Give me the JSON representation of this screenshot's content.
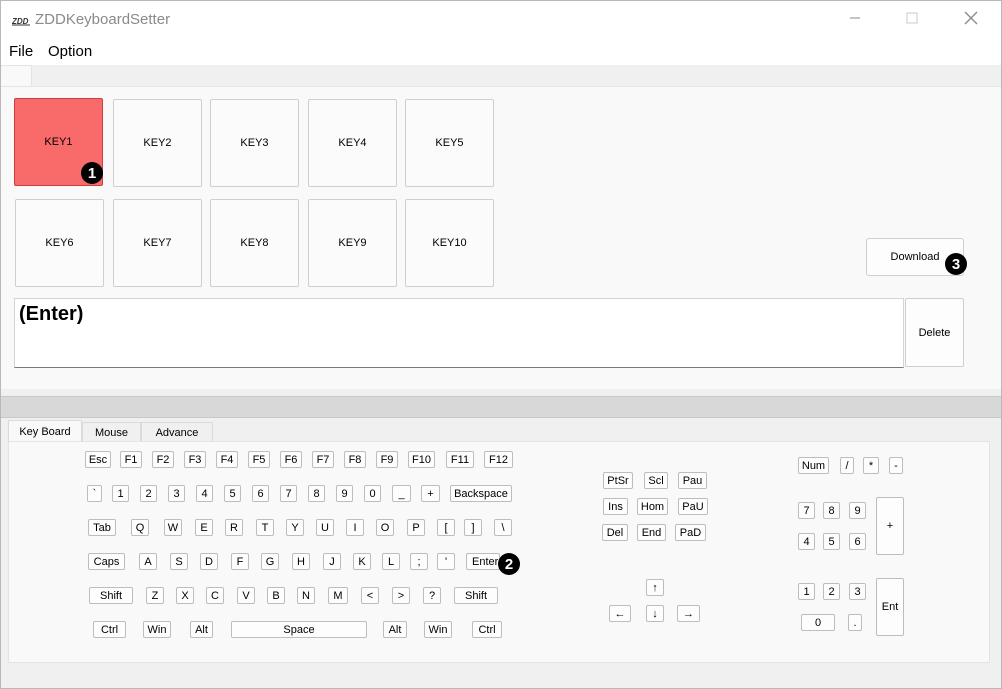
{
  "window": {
    "title": "ZDDKeyboardSetter",
    "icon": "zdd-logo-icon",
    "controls": [
      "minimize-icon",
      "maximize-icon",
      "close-icon"
    ]
  },
  "menu": {
    "file": "File",
    "option": "Option"
  },
  "keys": [
    {
      "label": "KEY1",
      "selected": true
    },
    {
      "label": "KEY2"
    },
    {
      "label": "KEY3"
    },
    {
      "label": "KEY4"
    },
    {
      "label": "KEY5"
    },
    {
      "label": "KEY6"
    },
    {
      "label": "KEY7"
    },
    {
      "label": "KEY8"
    },
    {
      "label": "KEY9"
    },
    {
      "label": "KEY10"
    }
  ],
  "download_label": "Download",
  "macro_text": "(Enter)",
  "delete_label": "Delete",
  "badges": {
    "b1": "1",
    "b2": "2",
    "b3": "3"
  },
  "tabs": {
    "keyboard": "Key Board",
    "mouse": "Mouse",
    "advance": "Advance"
  },
  "kb": {
    "fn": [
      "Esc",
      "F1",
      "F2",
      "F3",
      "F4",
      "F5",
      "F6",
      "F7",
      "F8",
      "F9",
      "F10",
      "F11",
      "F12"
    ],
    "num": [
      "`",
      "1",
      "2",
      "3",
      "4",
      "5",
      "6",
      "7",
      "8",
      "9",
      "0",
      "_",
      "+",
      "Backspace"
    ],
    "qwerty": [
      "Tab",
      "Q",
      "W",
      "E",
      "R",
      "T",
      "Y",
      "U",
      "I",
      "O",
      "P",
      "[",
      "]",
      "\\"
    ],
    "home": [
      "Caps",
      "A",
      "S",
      "D",
      "F",
      "G",
      "H",
      "J",
      "K",
      "L",
      ";",
      "'",
      "Enter"
    ],
    "shift": [
      "Shift",
      "Z",
      "X",
      "C",
      "V",
      "B",
      "N",
      "M",
      "<",
      ">",
      "?",
      "Shift"
    ],
    "bottom": [
      "Ctrl",
      "Win",
      "Alt",
      "Space",
      "Alt",
      "Win",
      "Ctrl"
    ],
    "nav": [
      "PtSr",
      "Scl",
      "Pau",
      "Ins",
      "Hom",
      "PaU",
      "Del",
      "End",
      "PaD"
    ],
    "arrows": [
      "↑",
      "←",
      "↓",
      "→"
    ],
    "numpad": [
      "Num",
      "/",
      "*",
      "-",
      "7",
      "8",
      "9",
      "+",
      "4",
      "5",
      "6",
      "1",
      "2",
      "3",
      "Ent",
      "0",
      "."
    ]
  },
  "colors": {
    "selected_key": "#f96a6a",
    "badge": "#000000"
  }
}
